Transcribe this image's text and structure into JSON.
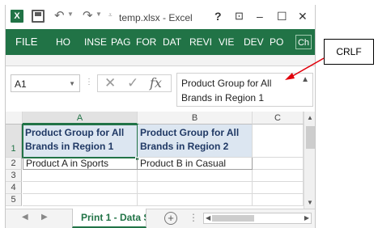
{
  "window": {
    "title": "temp.xlsx - Excel",
    "help_label": "?",
    "minimize_label": "–",
    "maximize_label": "☐",
    "close_label": "✕"
  },
  "quick_access": {
    "app_icon": "excel-logo-icon",
    "save_icon": "save-icon",
    "undo_icon": "undo-icon",
    "redo_icon": "redo-icon",
    "customize_icon": "customize-qat-icon"
  },
  "ribbon": {
    "tabs": [
      "FILE",
      "HO",
      "INSE",
      "PAG",
      "FOR",
      "DAT",
      "REVI",
      "VIE",
      "DEV",
      "PO",
      "Ch"
    ],
    "more_icon": "ribbon-scroll-right-icon",
    "accent": "#217346"
  },
  "formula_bar": {
    "name_box": "A1",
    "cancel_icon": "cancel-icon",
    "enter_icon": "enter-checkmark-icon",
    "fx_label": "fx",
    "content_lines": [
      "Product Group for All",
      "Brands in Region 1"
    ],
    "expand_icon": "collapse-formula-bar-icon"
  },
  "grid": {
    "columns": [
      "A",
      "B",
      "C"
    ],
    "rows": [
      "1",
      "2",
      "3",
      "4",
      "5"
    ],
    "cells": {
      "A1_lines": [
        "Product Group for All",
        "Brands in Region 1"
      ],
      "B1_lines": [
        "Product Group for All",
        "Brands in Region 2"
      ],
      "A2": "Product A in Sports",
      "B2": "Product B in Casual"
    },
    "active_cell": "A1",
    "header_fill": "#dce6f1"
  },
  "sheets": {
    "active_tab": "Print 1 - Data S",
    "add_sheet_label": "+"
  },
  "annotation": {
    "callout_text": "CRLF",
    "arrow_color": "#e0000b"
  }
}
